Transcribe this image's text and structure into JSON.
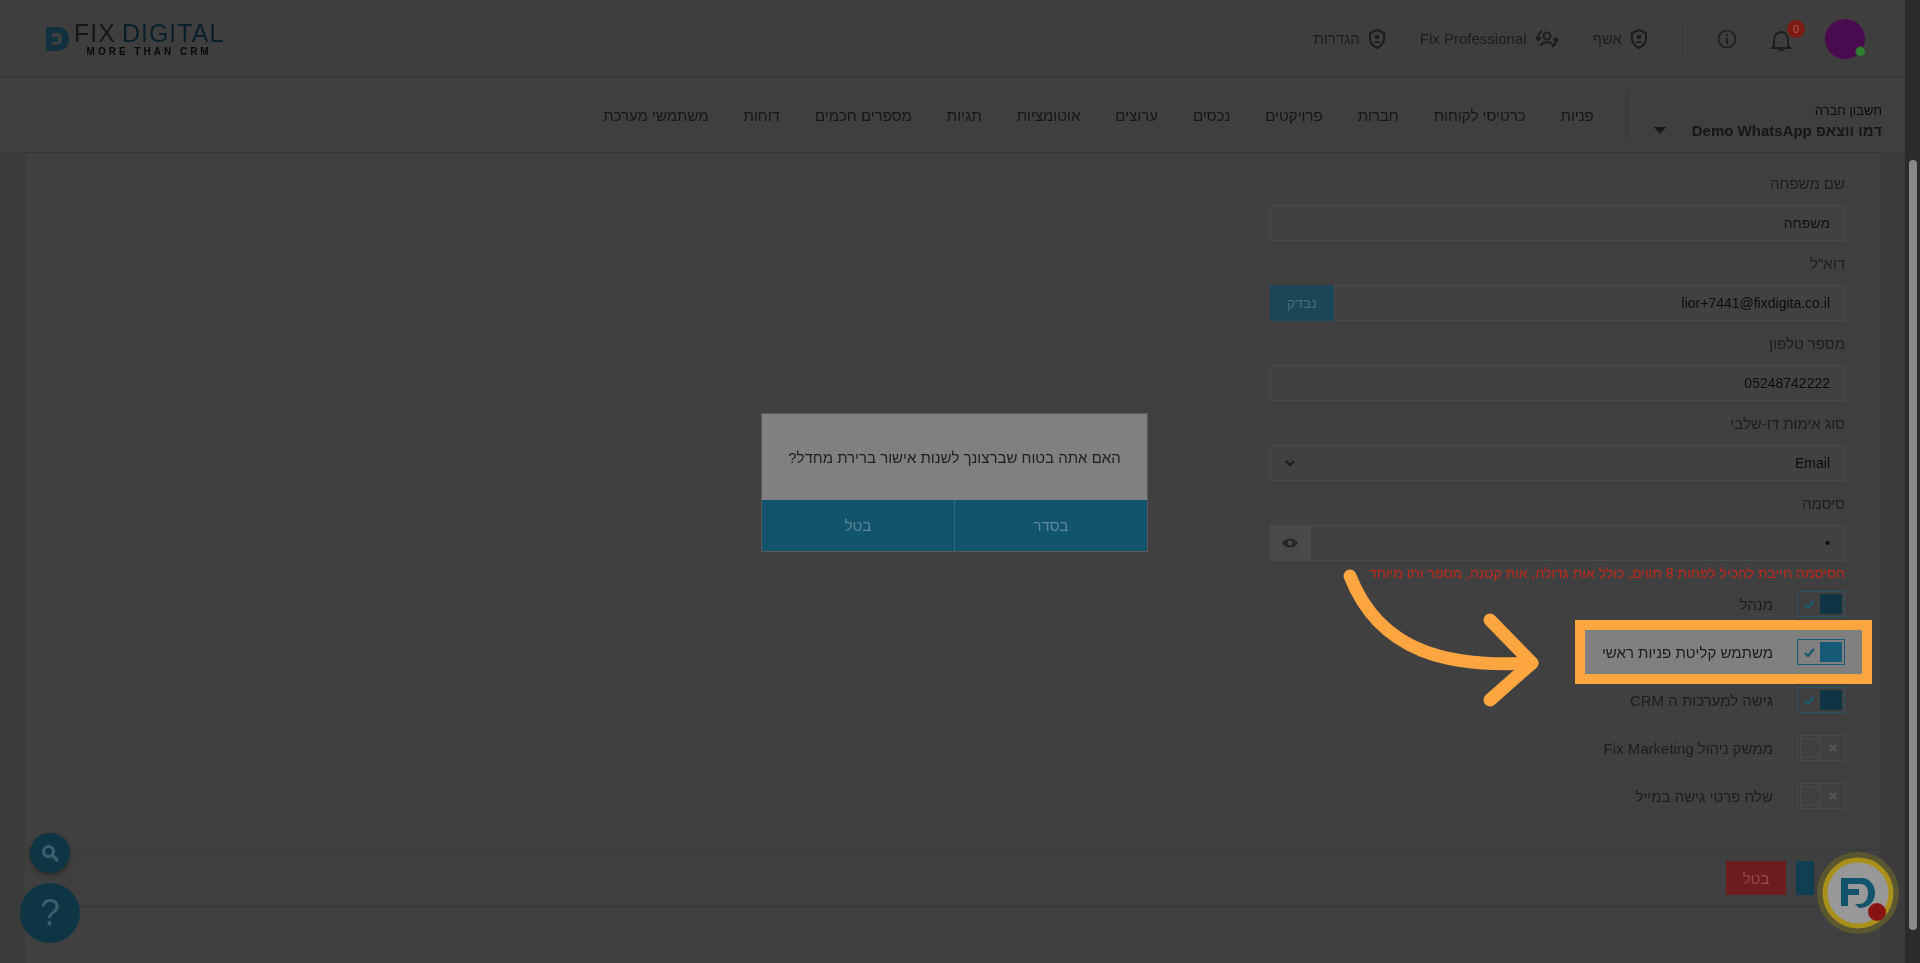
{
  "header": {
    "logo": {
      "word_1": "FIX",
      "word_2": "DIGITAL",
      "tagline": "MORE THAN CRM"
    },
    "links": [
      {
        "label": "אשף",
        "kind": "wizard"
      },
      {
        "label": "Fix Professional",
        "kind": "switch"
      },
      {
        "label": "הגדרות",
        "kind": "settings"
      }
    ],
    "notifications_badge": "0"
  },
  "nav": {
    "account_label": "חשבון חברה",
    "account_name": "דמו ווצאפ Demo WhatsApp",
    "items": [
      "פניות",
      "כרטיסי לקוחות",
      "חברות",
      "פרויקטים",
      "נכסים",
      "ערוצים",
      "אוטומציות",
      "תגיות",
      "מספרים חכמים",
      "דוחות",
      "משתמשי מערכת"
    ]
  },
  "form": {
    "fields": [
      {
        "label": "שם משפחה",
        "kind": "text",
        "placeholder": "משפחה"
      },
      {
        "label": "דוא\"ל",
        "kind": "email",
        "value": "lior+7441@fixdigita.co.il",
        "button": "נבדק"
      },
      {
        "label": "מספר טלפון",
        "kind": "text",
        "value": "05248742222"
      },
      {
        "label": "סוג אימות דו-שלבי",
        "kind": "select",
        "value": "Email"
      },
      {
        "label": "סיסמה",
        "kind": "password",
        "value": "•"
      }
    ],
    "password_hint": "הסיסמה חייבת להכיל לפחות 8 תווים, כולל אות גדולה, אות קטנה, מספר ותו מיוחד",
    "toggles": [
      {
        "label": "מנהל",
        "on": true,
        "highlighted": false
      },
      {
        "label": "משתמש קליטת פניות ראשי",
        "on": true,
        "highlighted": true
      },
      {
        "label": "גישה למערכות ה CRM",
        "on": true,
        "highlighted": false
      },
      {
        "label": "ממשק ניהול Fix Marketing",
        "on": false,
        "highlighted": false
      },
      {
        "label": "שלח פרטי גישה במייל",
        "on": false,
        "highlighted": false
      }
    ]
  },
  "footer_buttons": [
    {
      "label": "בטל",
      "kind": "cancel"
    },
    {
      "kind": "save"
    }
  ],
  "dialog": {
    "message": "האם אתה בטוח שברצונך לשנות אישור ברירת מחדל?",
    "buttons": [
      {
        "label": "בסדר"
      },
      {
        "label": "בטל"
      }
    ]
  },
  "help_button": "?"
}
